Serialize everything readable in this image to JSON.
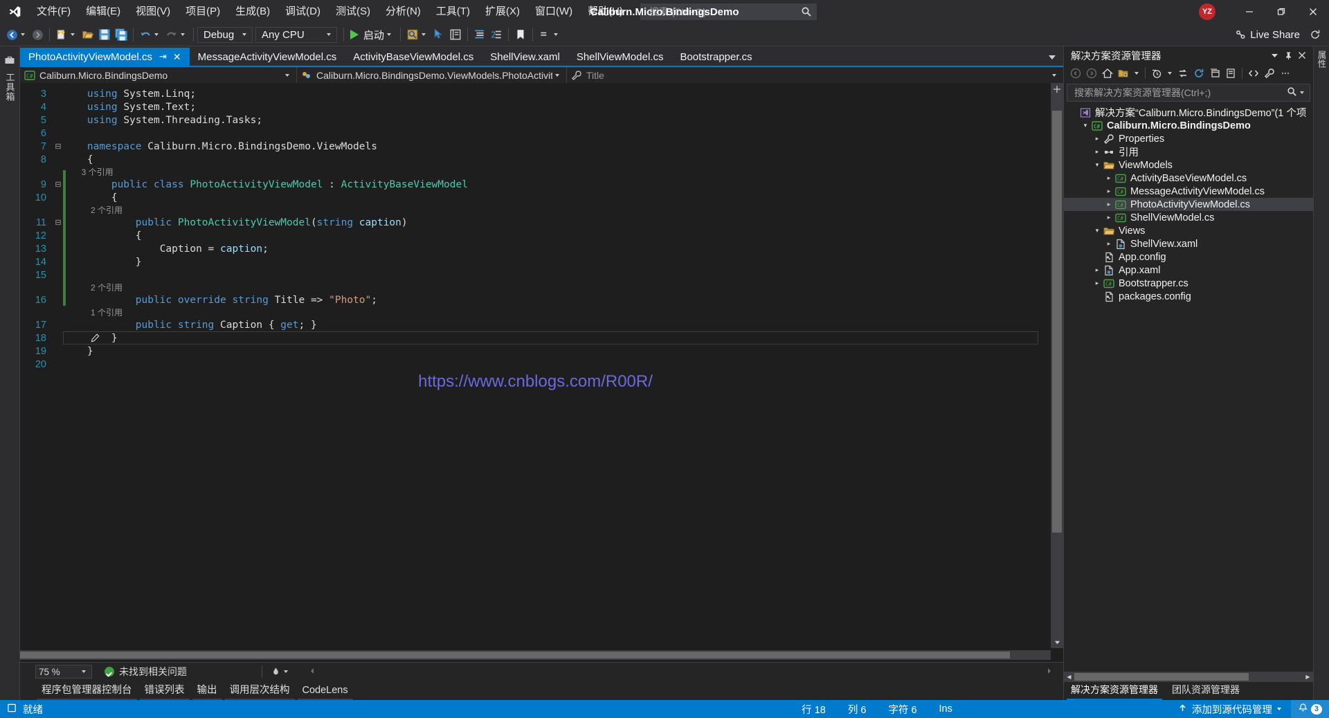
{
  "window": {
    "title": "Caliburn.Micro.BindingsDemo",
    "avatar_initials": "YZ",
    "minimize": "—",
    "restore": "❐",
    "close": "✕"
  },
  "menu": {
    "items": [
      {
        "label": "文件(F)"
      },
      {
        "label": "编辑(E)"
      },
      {
        "label": "视图(V)"
      },
      {
        "label": "项目(P)"
      },
      {
        "label": "生成(B)"
      },
      {
        "label": "调试(D)"
      },
      {
        "label": "测试(S)"
      },
      {
        "label": "分析(N)"
      },
      {
        "label": "工具(T)"
      },
      {
        "label": "扩展(X)"
      },
      {
        "label": "窗口(W)"
      },
      {
        "label": "帮助(H)"
      }
    ],
    "search_placeholder": "搜索 (Ctrl+Q)",
    "search_value": ""
  },
  "toolbar": {
    "configuration": "Debug",
    "platform": "Any CPU",
    "run_label": "启动",
    "live_share": "Live Share"
  },
  "editor_tabs": [
    {
      "label": "PhotoActivityViewModel.cs",
      "active": true,
      "pin": "⇥",
      "close": "✕"
    },
    {
      "label": "MessageActivityViewModel.cs",
      "active": false
    },
    {
      "label": "ActivityBaseViewModel.cs",
      "active": false
    },
    {
      "label": "ShellView.xaml",
      "active": false
    },
    {
      "label": "ShellViewModel.cs",
      "active": false
    },
    {
      "label": "Bootstrapper.cs",
      "active": false
    }
  ],
  "navbar": {
    "project": "Caliburn.Micro.BindingsDemo",
    "type": "Caliburn.Micro.BindingsDemo.ViewModels.PhotoActivityVie",
    "member": "Title"
  },
  "code": {
    "watermark": "https://www.cnblogs.com/R00R/",
    "lines": [
      {
        "n": "3",
        "lens": null,
        "fold": "",
        "indent": 1,
        "tokens": [
          {
            "t": "using ",
            "c": "k"
          },
          {
            "t": "System.Linq;",
            "c": "w"
          }
        ]
      },
      {
        "n": "4",
        "lens": null,
        "fold": "",
        "indent": 1,
        "tokens": [
          {
            "t": "using ",
            "c": "k"
          },
          {
            "t": "System.Text;",
            "c": "w"
          }
        ]
      },
      {
        "n": "5",
        "lens": null,
        "fold": "",
        "indent": 1,
        "tokens": [
          {
            "t": "using ",
            "c": "k"
          },
          {
            "t": "System.Threading.Tasks;",
            "c": "w"
          }
        ]
      },
      {
        "n": "6",
        "lens": null,
        "fold": "",
        "indent": 1,
        "tokens": []
      },
      {
        "n": "7",
        "lens": null,
        "fold": "⊟",
        "indent": 1,
        "tokens": [
          {
            "t": "namespace ",
            "c": "k"
          },
          {
            "t": "Caliburn.Micro.BindingsDemo.ViewModels",
            "c": "w"
          }
        ]
      },
      {
        "n": "8",
        "lens": null,
        "fold": "",
        "indent": 1,
        "tokens": [
          {
            "t": "{",
            "c": "w"
          }
        ]
      },
      {
        "n": "9",
        "lens": "3 个引用",
        "fold": "⊟",
        "indent": 2,
        "tokens": [
          {
            "t": "public class ",
            "c": "k"
          },
          {
            "t": "PhotoActivityViewModel",
            "c": "t"
          },
          {
            "t": " : ",
            "c": "w"
          },
          {
            "t": "ActivityBaseViewModel",
            "c": "t"
          }
        ]
      },
      {
        "n": "10",
        "lens": null,
        "fold": "",
        "indent": 2,
        "tokens": [
          {
            "t": "{",
            "c": "w"
          }
        ]
      },
      {
        "n": "11",
        "lens": "2 个引用",
        "fold": "⊟",
        "indent": 3,
        "tokens": [
          {
            "t": "public ",
            "c": "k"
          },
          {
            "t": "PhotoActivityViewModel",
            "c": "t"
          },
          {
            "t": "(",
            "c": "w"
          },
          {
            "t": "string ",
            "c": "k"
          },
          {
            "t": "caption",
            "c": "id"
          },
          {
            "t": ")",
            "c": "w"
          }
        ]
      },
      {
        "n": "12",
        "lens": null,
        "fold": "",
        "indent": 3,
        "tokens": [
          {
            "t": "{",
            "c": "w"
          }
        ]
      },
      {
        "n": "13",
        "lens": null,
        "fold": "",
        "indent": 4,
        "tokens": [
          {
            "t": "Caption = ",
            "c": "w"
          },
          {
            "t": "caption",
            "c": "id"
          },
          {
            "t": ";",
            "c": "w"
          }
        ]
      },
      {
        "n": "14",
        "lens": null,
        "fold": "",
        "indent": 3,
        "tokens": [
          {
            "t": "}",
            "c": "w"
          }
        ]
      },
      {
        "n": "15",
        "lens": null,
        "fold": "",
        "indent": 3,
        "tokens": []
      },
      {
        "n": "16",
        "lens": "2 个引用",
        "fold": "",
        "indent": 3,
        "tokens": [
          {
            "t": "public override string ",
            "c": "k"
          },
          {
            "t": "Title",
            "c": "w"
          },
          {
            "t": " => ",
            "c": "w"
          },
          {
            "t": "\"Photo\"",
            "c": "s"
          },
          {
            "t": ";",
            "c": "w"
          }
        ]
      },
      {
        "n": "17",
        "lens": "1 个引用",
        "fold": "",
        "indent": 3,
        "tokens": [
          {
            "t": "public string ",
            "c": "k"
          },
          {
            "t": "Caption",
            "c": "w"
          },
          {
            "t": " { ",
            "c": "w"
          },
          {
            "t": "get",
            "c": "k"
          },
          {
            "t": "; }",
            "c": "w"
          }
        ]
      },
      {
        "n": "18",
        "lens": null,
        "fold": "",
        "indent": 2,
        "tokens": [
          {
            "t": "}",
            "c": "w"
          }
        ],
        "current": true
      },
      {
        "n": "19",
        "lens": null,
        "fold": "",
        "indent": 1,
        "tokens": [
          {
            "t": "}",
            "c": "w"
          }
        ]
      },
      {
        "n": "20",
        "lens": null,
        "fold": "",
        "indent": 1,
        "tokens": []
      }
    ]
  },
  "editor_status": {
    "zoom": "75 %",
    "issues": "未找到相关问题"
  },
  "bottom_tabs": [
    {
      "label": "程序包管理器控制台"
    },
    {
      "label": "错误列表"
    },
    {
      "label": "输出"
    },
    {
      "label": "调用层次结构"
    },
    {
      "label": "CodeLens"
    }
  ],
  "solution_explorer": {
    "title": "解决方案资源管理器",
    "search_placeholder": "搜索解决方案资源管理器(Ctrl+;)",
    "search_value": "",
    "tree": [
      {
        "label": "解决方案“Caliburn.Micro.BindingsDemo”(1 个项",
        "indent": 0,
        "arrow": "",
        "icon": "solution-icon",
        "bold": false,
        "selected": false
      },
      {
        "label": "Caliburn.Micro.BindingsDemo",
        "indent": 1,
        "arrow": "▾",
        "icon": "csproj-icon",
        "bold": true,
        "selected": false
      },
      {
        "label": "Properties",
        "indent": 2,
        "arrow": "▸",
        "icon": "wrench-icon",
        "bold": false,
        "selected": false
      },
      {
        "label": "引用",
        "indent": 2,
        "arrow": "▸",
        "icon": "references-icon",
        "bold": false,
        "selected": false
      },
      {
        "label": "ViewModels",
        "indent": 2,
        "arrow": "▾",
        "icon": "folder-icon",
        "bold": false,
        "selected": false
      },
      {
        "label": "ActivityBaseViewModel.cs",
        "indent": 3,
        "arrow": "▸",
        "icon": "cs-icon",
        "bold": false,
        "selected": false
      },
      {
        "label": "MessageActivityViewModel.cs",
        "indent": 3,
        "arrow": "▸",
        "icon": "cs-icon",
        "bold": false,
        "selected": false
      },
      {
        "label": "PhotoActivityViewModel.cs",
        "indent": 3,
        "arrow": "▸",
        "icon": "cs-icon",
        "bold": false,
        "selected": true
      },
      {
        "label": "ShellViewModel.cs",
        "indent": 3,
        "arrow": "▸",
        "icon": "cs-icon",
        "bold": false,
        "selected": false
      },
      {
        "label": "Views",
        "indent": 2,
        "arrow": "▾",
        "icon": "folder-icon",
        "bold": false,
        "selected": false
      },
      {
        "label": "ShellView.xaml",
        "indent": 3,
        "arrow": "▸",
        "icon": "xaml-icon",
        "bold": false,
        "selected": false
      },
      {
        "label": "App.config",
        "indent": 2,
        "arrow": "",
        "icon": "config-icon",
        "bold": false,
        "selected": false
      },
      {
        "label": "App.xaml",
        "indent": 2,
        "arrow": "▸",
        "icon": "xaml-icon",
        "bold": false,
        "selected": false
      },
      {
        "label": "Bootstrapper.cs",
        "indent": 2,
        "arrow": "▸",
        "icon": "cs-icon",
        "bold": false,
        "selected": false
      },
      {
        "label": "packages.config",
        "indent": 2,
        "arrow": "",
        "icon": "config-icon",
        "bold": false,
        "selected": false
      }
    ],
    "footer_tabs": [
      {
        "label": "解决方案资源管理器",
        "active": true
      },
      {
        "label": "团队资源管理器",
        "active": false
      }
    ]
  },
  "right_dock": {
    "items": [
      {
        "label": "属性"
      }
    ]
  },
  "left_dock": {
    "items": [
      {
        "label": "工具箱"
      }
    ]
  },
  "statusbar": {
    "ready": "就绪",
    "row": "行 18",
    "col": "列 6",
    "chars": "字符 6",
    "insert": "Ins",
    "source_control": "添加到源代码管理",
    "notifications": "3"
  },
  "colors": {
    "accent": "#007acc",
    "chrome": "#2d2d30",
    "editor_bg": "#1e1e1e",
    "panel_bg": "#252526",
    "avatar": "#c1272d",
    "keyword": "#569cd6",
    "type": "#4ec9b0",
    "string": "#d69d85",
    "linenum": "#2b91af",
    "watermark": "#6a6adf"
  }
}
